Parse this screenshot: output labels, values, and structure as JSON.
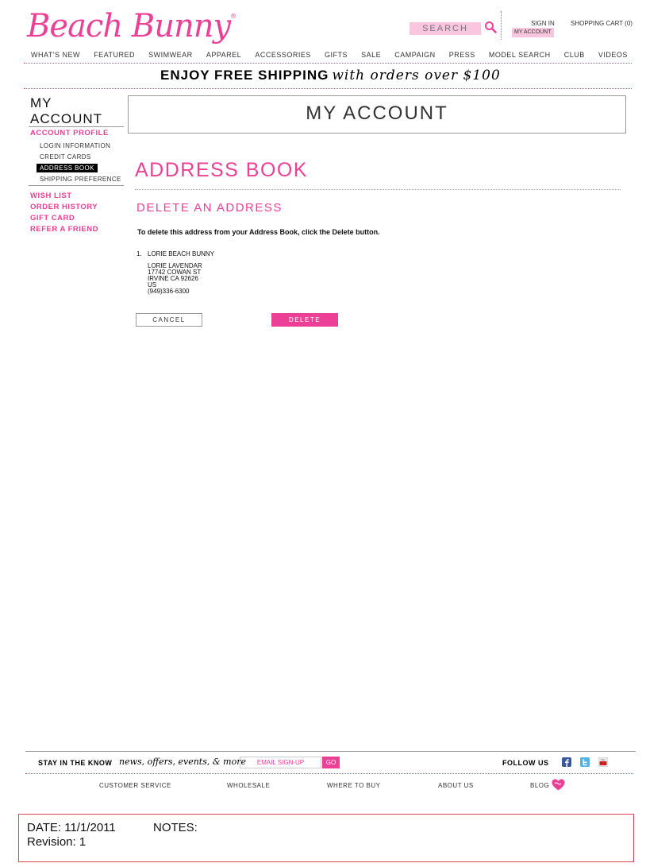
{
  "header": {
    "logo": "Beach Bunny",
    "logo_mark": "®",
    "search_placeholder": "SEARCH",
    "sign_in": "SIGN IN",
    "my_account": "MY ACCOUNT",
    "cart": "SHOPPING CART (0)"
  },
  "nav": [
    "WHAT'S NEW",
    "FEATURED",
    "SWIMWEAR",
    "APPAREL",
    "ACCESSORIES",
    "GIFTS",
    "SALE",
    "CAMPAIGN",
    "PRESS",
    "MODEL SEARCH",
    "CLUB",
    "VIDEOS"
  ],
  "promo": {
    "bold": "ENJOY FREE SHIPPING",
    "italic": "with orders over $100"
  },
  "sidebar": {
    "title_line1": "MY",
    "title_line2": "ACCOUNT",
    "profile": "ACCOUNT PROFILE",
    "sub_items": [
      "LOGIN INFORMATION",
      "CREDIT CARDS",
      "ADDRESS BOOK",
      "SHIPPING PREFERENCE"
    ],
    "links": [
      "WISH LIST",
      "ORDER HISTORY",
      "GIFT CARD",
      "REFER A FRIEND"
    ]
  },
  "main": {
    "title": "MY ACCOUNT",
    "section": "ADDRESS BOOK",
    "subsection": "DELETE AN ADDRESS",
    "instruction": "To delete this address from your Address Book, click the Delete button.",
    "address": {
      "number": "1.",
      "nickname": "LORIE BEACH BUNNY",
      "name": "LORIE LAVENDAR",
      "street": "17742 COWAN ST",
      "city": "IRVINE CA 92626",
      "country": "US",
      "phone": "(949)336-6300"
    },
    "cancel": "CANCEL",
    "delete": "DELETE"
  },
  "footer": {
    "stay": "STAY IN THE KNOW",
    "stay_italic": "news, offers, events, & more",
    "email_placeholder": "EMAIL SIGN-UP",
    "go": "GO",
    "follow": "FOLLOW US",
    "links": [
      "CUSTOMER SERVICE",
      "WHOLESALE",
      "WHERE TO BUY",
      "ABOUT US",
      "BLOG"
    ]
  },
  "annotation": {
    "date": "DATE: 11/1/2011",
    "revision": "Revision: 1",
    "notes": "NOTES:"
  },
  "colors": {
    "accent": "#ec3f96",
    "accent_light": "#f9c5df"
  }
}
